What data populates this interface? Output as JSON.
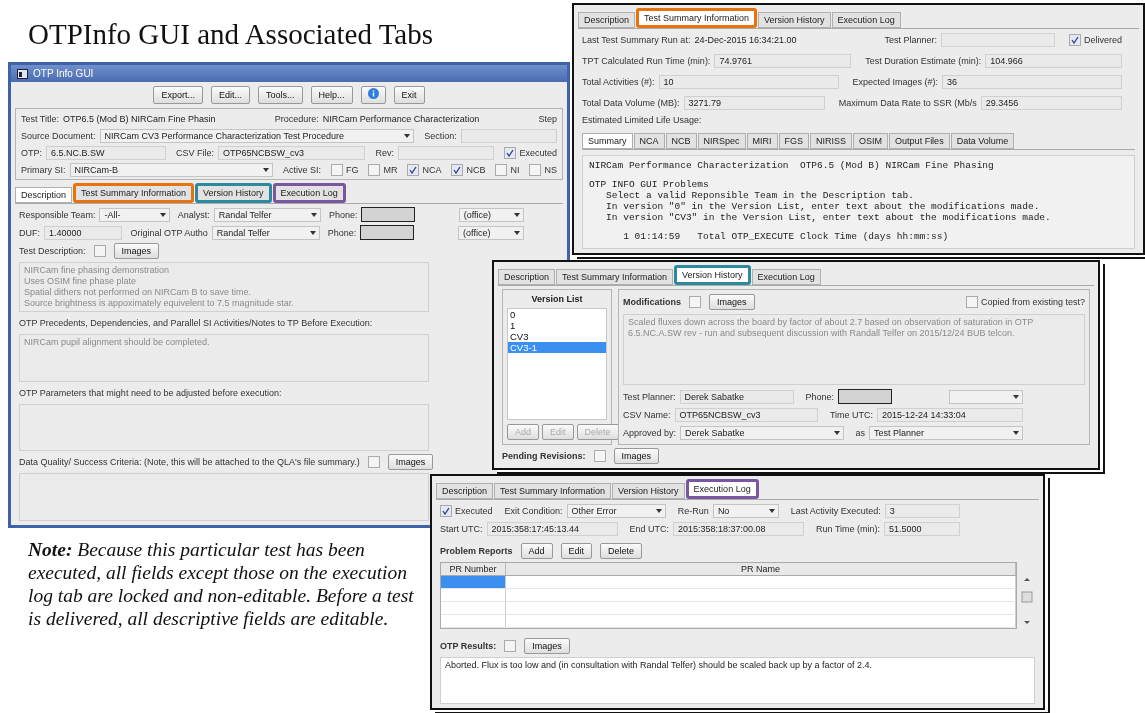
{
  "slide_title": "OTPInfo GUI and Associated Tabs",
  "note": "**Note:** Because this particular test has been executed, all fields except those on the execution log tab are locked and non-editable.  Before a test is delivered, all descriptive fields are editable.",
  "main_window": {
    "title": "OTP Info GUI",
    "toolbar": [
      {
        "kind": "text",
        "label": "Export..."
      },
      {
        "kind": "text",
        "label": "Edit..."
      },
      {
        "kind": "text",
        "label": "Tools..."
      },
      {
        "kind": "text",
        "label": "Help..."
      },
      {
        "kind": "info"
      },
      {
        "kind": "text",
        "label": "Exit"
      }
    ],
    "header_rows": [
      {
        "fields": [
          {
            "label": "Test Title:",
            "kind": "text",
            "value": "OTP6.5 (Mod B) NIRCam Fine Phasin"
          },
          {
            "label": "Procedure:",
            "kind": "text",
            "value": "NIRCam Performance Characterization"
          },
          {
            "label": "Step",
            "kind": "label"
          }
        ]
      },
      {
        "fields": [
          {
            "label": "Source Document:",
            "kind": "dropdown",
            "value": "NIRCam CV3 Performance Characterization Test Procedure"
          },
          {
            "label": "Section:",
            "kind": "field"
          }
        ]
      },
      {
        "fields": [
          {
            "label": "OTP:",
            "kind": "field",
            "value": "6.5.NC.B.SW"
          },
          {
            "label": "CSV File:",
            "kind": "field",
            "value": "OTP65NCBSW_cv3"
          },
          {
            "label": "Rev:",
            "kind": "field"
          },
          {
            "kind": "check",
            "label": "Executed",
            "checked": true
          }
        ]
      },
      {
        "fields": [
          {
            "label": "Primary SI:",
            "kind": "dropdown",
            "value": "NIRCam-B"
          },
          {
            "label": "Active SI:",
            "kind": "label"
          },
          {
            "kind": "check",
            "label": "FG",
            "checked": false
          },
          {
            "kind": "check",
            "label": "MR",
            "checked": false
          },
          {
            "kind": "check",
            "label": "NCA",
            "checked": true
          },
          {
            "kind": "check",
            "label": "NCB",
            "checked": true
          },
          {
            "kind": "check",
            "label": "NI",
            "checked": false
          },
          {
            "kind": "check",
            "label": "NS",
            "checked": false
          }
        ]
      }
    ],
    "tabs": [
      {
        "label": "Description",
        "selected": true
      },
      {
        "label": "Test Summary Information",
        "selected": false,
        "color": "#e8730c"
      },
      {
        "label": "Version History",
        "selected": false,
        "color": "#2b8a9e"
      },
      {
        "label": "Execution Log",
        "selected": false,
        "color": "#7a56a0"
      }
    ],
    "rows": [
      {
        "fields": [
          {
            "label": "Responsible Team:",
            "kind": "dropdown",
            "value": "-All-"
          },
          {
            "label": "Analyst:",
            "kind": "dropdown",
            "value": "Randal Telfer"
          },
          {
            "label": "Phone:",
            "kind": "redacted"
          },
          {
            "kind": "dropdown",
            "value": "(office)"
          }
        ]
      },
      {
        "fields": [
          {
            "label": "DUF:",
            "kind": "field",
            "value": "1.40000"
          },
          {
            "label": "Original OTP Autho",
            "kind": "dropdown",
            "value": "Randal Telfer"
          },
          {
            "label": "Phone:",
            "kind": "redacted"
          },
          {
            "kind": "dropdown",
            "value": "(office)"
          }
        ]
      }
    ],
    "sections": [
      {
        "label": "Test Description:",
        "images": {
          "checked": false,
          "label": "Images"
        },
        "lines": [
          "NIRCam fine phasing demonstration",
          "Uses OSIM fine phase plate",
          "Spatial dithers not performed on NIRCam B to save time.",
          "Source brightness is appoximately equivelent to 7.5 magnitude star."
        ]
      },
      {
        "label": "OTP Precedents, Dependencies, and Parallel SI Activities/Notes to TP Before Execution:",
        "lines": [
          "NIRCam pupil alignment should be completed."
        ]
      },
      {
        "label": "OTP Parameters that might need to be adjusted before execution:"
      },
      {
        "label": "Data Quality/ Success Criteria:  (Note, this will be attached to the QLA's file summary.)",
        "images": {
          "checked": false,
          "label": "Images"
        }
      }
    ]
  },
  "summary_window": {
    "tabs": [
      {
        "label": "Description",
        "selected": false
      },
      {
        "label": "Test Summary Information",
        "selected": true,
        "color": "#e8730c"
      },
      {
        "label": "Version History",
        "selected": false
      },
      {
        "label": "Execution Log",
        "selected": false
      }
    ],
    "rows": [
      {
        "fields": [
          {
            "label": "Last Test Summary Run at:",
            "kind": "text",
            "value": "24-Dec-2015 16:34:21.00"
          },
          {
            "label": "Test Planner:",
            "kind": "field"
          },
          {
            "kind": "check",
            "label": "Delivered",
            "checked": true
          }
        ]
      },
      {
        "fields": [
          {
            "label": "TPT Calculated Run Time (min):",
            "kind": "field",
            "value": "74.9761"
          },
          {
            "label": "Test Duration Estimate (min):",
            "kind": "field",
            "value": "104.966"
          }
        ]
      },
      {
        "fields": [
          {
            "label": "Total Activities (#):",
            "kind": "field",
            "value": "10"
          },
          {
            "label": "Expected Images (#):",
            "kind": "field",
            "value": "36"
          }
        ]
      },
      {
        "fields": [
          {
            "label": "Total Data Volume (MB):",
            "kind": "field",
            "value": "3271.79"
          },
          {
            "label": "Maximum Data Rate to SSR (Mb/s",
            "kind": "field",
            "value": "29.3456"
          }
        ]
      }
    ],
    "life_usage_label": "Estimated Limited Life Usage:",
    "sub_tabs": [
      {
        "label": "Summary",
        "selected": true
      },
      {
        "label": "NCA",
        "selected": false
      },
      {
        "label": "NCB",
        "selected": false
      },
      {
        "label": "NIRSpec",
        "selected": false
      },
      {
        "label": "MIRI",
        "selected": false
      },
      {
        "label": "FGS",
        "selected": false
      },
      {
        "label": "NIRISS",
        "selected": false
      },
      {
        "label": "OSIM",
        "selected": false
      },
      {
        "label": "Output Files",
        "selected": false
      },
      {
        "label": "Data Volume",
        "selected": false
      }
    ],
    "summary_blocks": [
      [
        "NIRCam Performance Characterization  OTP6.5 (Mod B) NIRCam Fine Phasing"
      ],
      [
        "OTP INFO GUI Problems",
        "   Select a valid Reponsible Team in the Description tab.",
        "   In version \"0\" in the Version List, enter text about the modifications made.",
        "   In version \"CV3\" in the Version List, enter text about the modifications made."
      ],
      [
        "      1 01:14:59   Total OTP_EXECUTE Clock Time (days hh:mm:ss)"
      ]
    ]
  },
  "version_window": {
    "tabs": [
      {
        "label": "Description",
        "selected": false
      },
      {
        "label": "Test Summary Information",
        "selected": false
      },
      {
        "label": "Version History",
        "selected": true,
        "color": "#2b8a9e"
      },
      {
        "label": "Execution Log",
        "selected": false
      }
    ],
    "version_list": {
      "title": "Version List",
      "items": [
        {
          "label": "0",
          "selected": false
        },
        {
          "label": "1",
          "selected": false
        },
        {
          "label": "CV3",
          "selected": false
        },
        {
          "label": "CV3-1",
          "selected": true
        }
      ],
      "buttons": [
        {
          "label": "Add",
          "disabled": true
        },
        {
          "label": "Edit",
          "disabled": true
        },
        {
          "label": "Delete",
          "disabled": true
        }
      ]
    },
    "modifications": {
      "label": "Modifications",
      "images": {
        "checked": false,
        "label": "Images"
      },
      "copied": {
        "label": "Copied from existing test?",
        "checked": false
      },
      "text": "Scaled fluxes down across the board by factor of about 2.7 based on observation of saturation in OTP 6.5.NC.A.SW rev - run and subsequent discussion with Randall Telfer on 2015/12/24 BUB telcon."
    },
    "rows": [
      {
        "fields": [
          {
            "label": "Test Planner:",
            "kind": "field",
            "value": "Derek Sabatke"
          },
          {
            "label": "Phone:",
            "kind": "redacted"
          },
          {
            "kind": "dropdown"
          }
        ]
      },
      {
        "fields": [
          {
            "label": "CSV Name:",
            "kind": "field",
            "value": "OTP65NCBSW_cv3"
          },
          {
            "label": "Time UTC:",
            "kind": "field",
            "value": "2015-12-24 14:33:04"
          }
        ]
      },
      {
        "fields": [
          {
            "label": "Approved by:",
            "kind": "dropdown",
            "value": "Derek Sabatke"
          },
          {
            "label": "as",
            "kind": "dropdown",
            "value": "Test Planner"
          }
        ]
      }
    ],
    "pending": {
      "label": "Pending Revisions:",
      "images": {
        "checked": false,
        "label": "Images"
      }
    }
  },
  "execution_window": {
    "tabs": [
      {
        "label": "Description",
        "selected": false
      },
      {
        "label": "Test Summary Information",
        "selected": false
      },
      {
        "label": "Version History",
        "selected": false
      },
      {
        "label": "Execution Log",
        "selected": true,
        "color": "#7a56a0"
      }
    ],
    "rows": [
      {
        "fields": [
          {
            "kind": "check",
            "label": "Executed",
            "checked": true
          },
          {
            "label": "Exit Condition:",
            "kind": "dropdown",
            "value": "Other Error"
          },
          {
            "label": "Re-Run",
            "kind": "dropdown",
            "value": "No"
          },
          {
            "label": "Last Activity Executed:",
            "kind": "field",
            "value": "3"
          }
        ]
      },
      {
        "fields": [
          {
            "label": "Start UTC:",
            "kind": "field",
            "value": "2015:358:17:45:13.44"
          },
          {
            "label": "End UTC:",
            "kind": "field",
            "value": "2015:358:18:37:00.08"
          },
          {
            "label": "Run Time (min):",
            "kind": "field",
            "value": "51.5000"
          }
        ]
      }
    ],
    "problem_reports": {
      "label": "Problem Reports",
      "buttons": [
        {
          "label": "Add",
          "disabled": false
        },
        {
          "label": "Edit",
          "disabled": false
        },
        {
          "label": "Delete",
          "disabled": false
        }
      ],
      "columns": [
        "PR Number",
        "PR Name"
      ],
      "rows": [
        {
          "selected": true
        },
        {
          "selected": false
        },
        {
          "selected": false
        },
        {
          "selected": false
        }
      ]
    },
    "results": {
      "label": "OTP Results:",
      "images": {
        "checked": false,
        "label": "Images"
      },
      "text": "Aborted.  Flux is too low and (in consultation with Randal Telfer) should be scaled back up by a factor of 2.4."
    }
  }
}
